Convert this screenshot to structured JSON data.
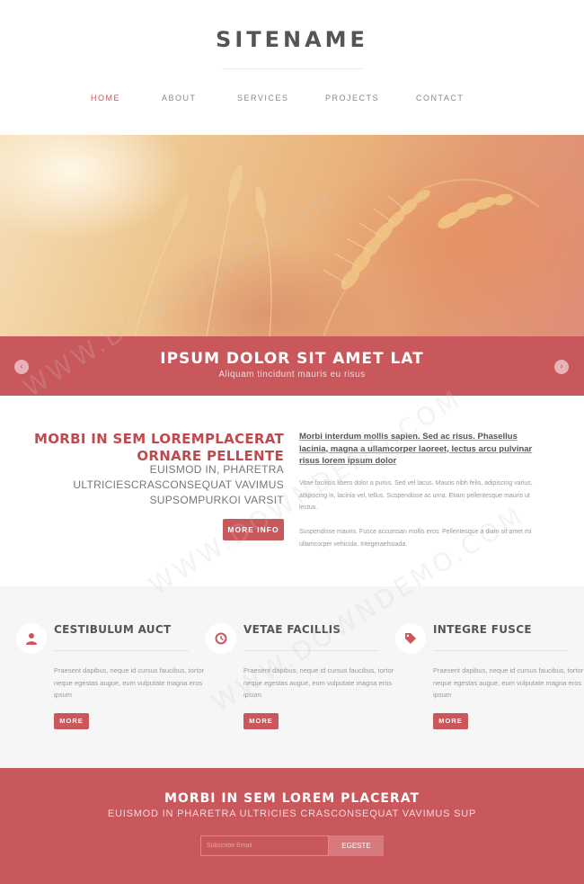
{
  "site": {
    "name": "SITENAME"
  },
  "nav": {
    "items": [
      {
        "label": "HOME",
        "active": true
      },
      {
        "label": "ABOUT",
        "active": false
      },
      {
        "label": "SERVICES",
        "active": false
      },
      {
        "label": "PROJECTS",
        "active": false
      },
      {
        "label": "CONTACT",
        "active": false
      }
    ]
  },
  "hero": {
    "title": "IPSUM DOLOR SIT AMET LAT",
    "subtitle": "Aliquam tincidunt mauris eu risus",
    "prev_arrow": "‹",
    "next_arrow": "›"
  },
  "intro": {
    "heading_line1": "MORBI IN SEM LOREMPLACERAT",
    "heading_line2": "ORNARE PELLENTE",
    "sub_line1": "EUISMOD IN, PHARETRA",
    "sub_line2": "ULTRICIESCRASCONSEQUAT VAVIMUS",
    "sub_line3": "SUPSOMPURKOI VARSIT",
    "button": "MORE INFO",
    "lead": "Morbi interdum mollis sapien. Sed ac risus. Phasellus lacinia, magna a ullamcorper laoreet, lectus arcu pulvinar risus lorem ipsum dolor",
    "para1": "Vitae facilisis libero dolor a purus. Sed vel lacus. Mauris nibh felis, adipiscing varius, adipiscing in, lacinia vel, tellus. Suspendisse ac urna. Etiam pellentesque mauris ut lectus.",
    "para2": "Suspendisse mauris. Fusce accumsan mollis eros. Pellentesque a diam sit amet mi ullamcorper vehicula. Integeraelsuada."
  },
  "features": [
    {
      "icon": "user-icon",
      "title": "CESTIBULUM AUCT",
      "text": "Praesent dapibus, neque id cursus faucibus, tortor neque egestas augue, eum vulputate magna eros ipsum",
      "button": "MORE"
    },
    {
      "icon": "clock-icon",
      "title": "VETAE FACILLIS",
      "text": "Praesent dapibus, neque id cursus faucibus, tortor neque egestas augue, eum vulputate magna eros ipsum",
      "button": "MORE"
    },
    {
      "icon": "tag-icon",
      "title": "INTEGRE FUSCE",
      "text": "Praesent dapibus, neque id cursus faucibus, tortor neque egestas augue, eum vulputate magna eros ipsum",
      "button": "MORE"
    }
  ],
  "footer": {
    "title": "MORBI IN SEM LOREM PLACERAT",
    "subtitle": "EUISMOD IN PHARETRA ULTRICIES CRASCONSEQUAT VAVIMUS SUP",
    "input_placeholder": "Subscribe Email",
    "button": "EGESTE"
  },
  "watermark": {
    "text": "WWW.DOWNDEMO.COM"
  },
  "colors": {
    "accent": "#c9585d",
    "heading": "#c0494f",
    "text": "#999999",
    "light_bg": "#f6f6f6"
  }
}
